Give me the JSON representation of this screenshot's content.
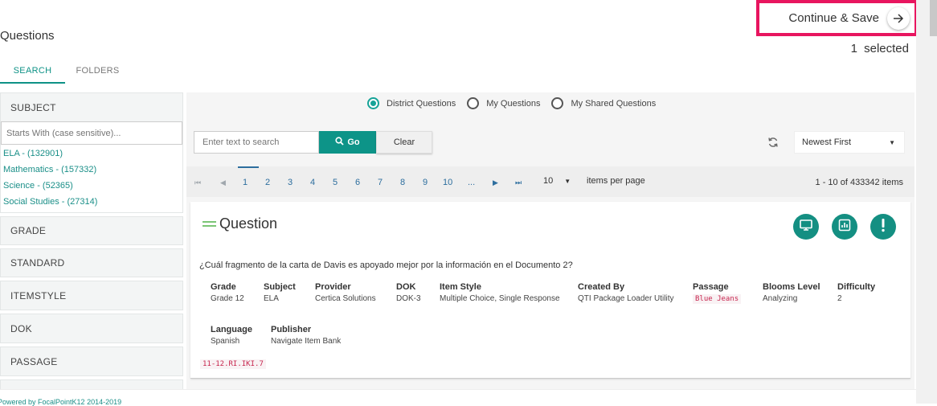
{
  "page": {
    "title": "Questions"
  },
  "header": {
    "continue_label": "Continue & Save",
    "continue_icon": "arrow-right-icon",
    "selected_text": "1 selected"
  },
  "tabs": [
    {
      "label": "SEARCH",
      "active": true
    },
    {
      "label": "FOLDERS",
      "active": false
    }
  ],
  "sidebar": {
    "subject": {
      "header": "SUBJECT",
      "filter_placeholder": "Starts With (case sensitive)...",
      "items": [
        "ELA - (132901)",
        "Mathematics - (157332)",
        "Science - (52365)",
        "Social Studies - (27314)"
      ]
    },
    "facets": [
      "GRADE",
      "STANDARD",
      "ITEMSTYLE",
      "DOK",
      "PASSAGE",
      "PROVIDER"
    ]
  },
  "scope": {
    "options": [
      "District Questions",
      "My Questions",
      "My Shared Questions"
    ],
    "selected": "District Questions"
  },
  "search": {
    "placeholder": "Enter text to search",
    "go_label": "Go",
    "clear_label": "Clear"
  },
  "sort": {
    "selected": "Newest First"
  },
  "pager": {
    "pages": [
      "1",
      "2",
      "3",
      "4",
      "5",
      "6",
      "7",
      "8",
      "9",
      "10",
      "..."
    ],
    "current": "1",
    "per_page": "10",
    "per_page_label": "items per page",
    "range": "1 - 10 of 433342 items"
  },
  "card": {
    "title": "Question",
    "actions": [
      "monitor-icon",
      "chart-icon",
      "alert-icon"
    ],
    "question": "¿Cuál fragmento de la carta de Davis es apoyado mejor por la información en el Documento 2?",
    "meta": {
      "grade": {
        "label": "Grade",
        "value": "Grade 12"
      },
      "subject": {
        "label": "Subject",
        "value": "ELA"
      },
      "provider": {
        "label": "Provider",
        "value": "Certica Solutions"
      },
      "dok": {
        "label": "DOK",
        "value": "DOK-3"
      },
      "item_style": {
        "label": "Item Style",
        "value": "Multiple Choice, Single Response"
      },
      "created_by": {
        "label": "Created By",
        "value": "QTI Package Loader Utility"
      },
      "passage": {
        "label": "Passage",
        "value": "Blue Jeans"
      },
      "blooms": {
        "label": "Blooms Level",
        "value": "Analyzing"
      },
      "difficulty": {
        "label": "Difficulty",
        "value": "2"
      },
      "language": {
        "label": "Language",
        "value": "Spanish"
      },
      "publisher": {
        "label": "Publisher",
        "value": "Navigate Item Bank"
      }
    },
    "standard_code": "11-12.RI.IKI.7"
  },
  "footer": {
    "text": "Powered by FocalPointK12 2014-2019"
  },
  "colors": {
    "accent": "#0d9488",
    "highlight_border": "#e8155f",
    "link": "#1a8f88",
    "pager": "#2d6e9e"
  }
}
